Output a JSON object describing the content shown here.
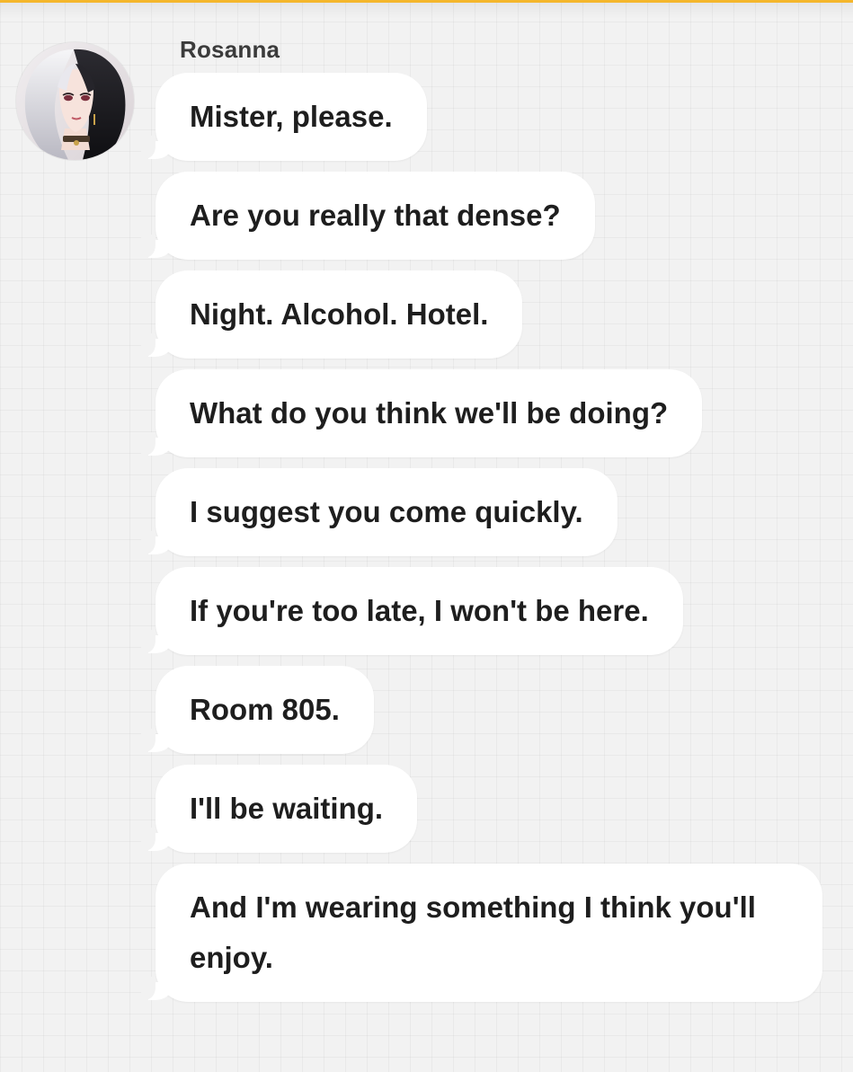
{
  "chat": {
    "sender_name": "Rosanna",
    "avatar_icon": "character-portrait-avatar",
    "accent_color": "#f4b62c",
    "bubble_color": "#ffffff",
    "messages": [
      {
        "text": "Mister, please."
      },
      {
        "text": "Are you really that dense?"
      },
      {
        "text": "Night. Alcohol. Hotel."
      },
      {
        "text": "What do you think we'll be doing?"
      },
      {
        "text": "I suggest you come quickly."
      },
      {
        "text": "If you're too late, I won't be here."
      },
      {
        "text": "Room 805."
      },
      {
        "text": "I'll be waiting."
      },
      {
        "text": "And I'm wearing something I think you'll enjoy."
      }
    ]
  }
}
